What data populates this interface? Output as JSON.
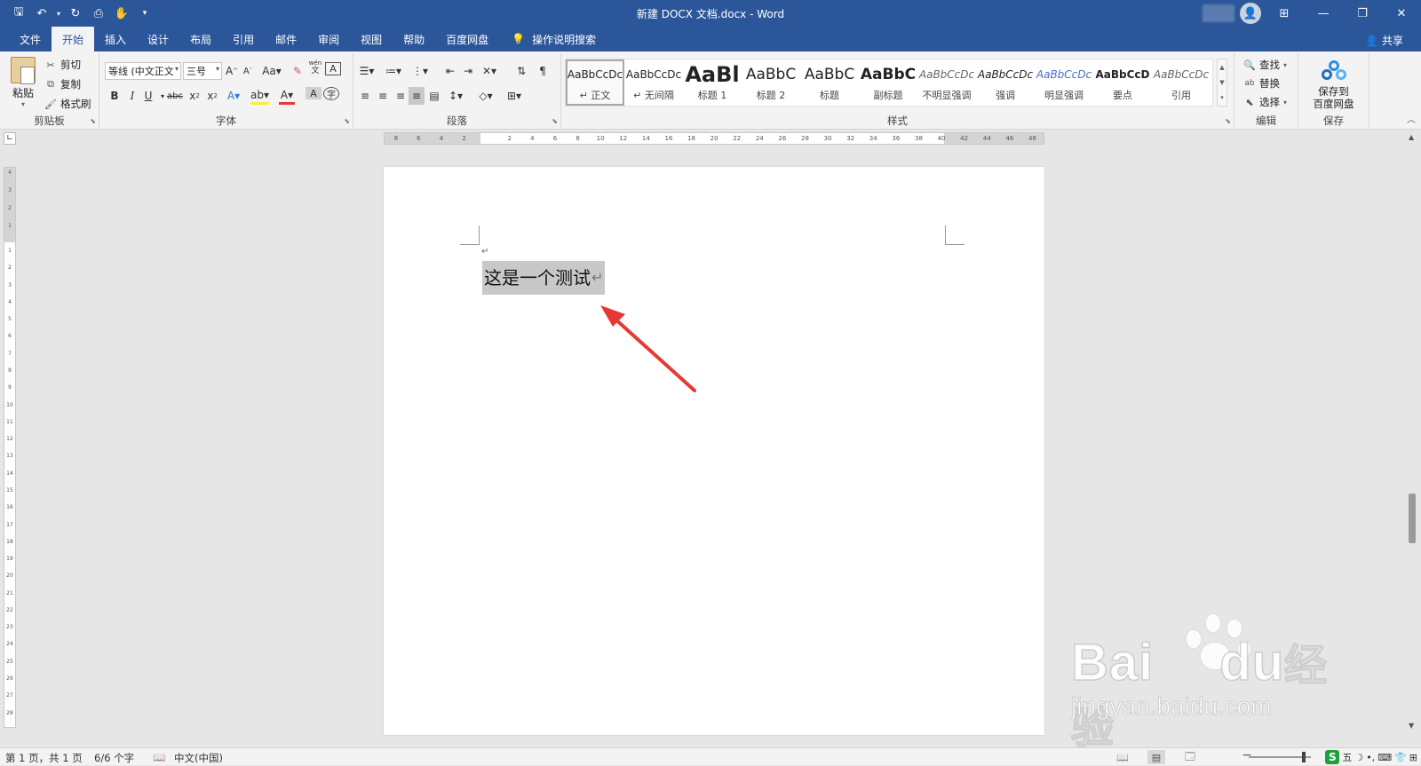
{
  "window": {
    "title": "新建 DOCX 文档.docx  -  Word"
  },
  "tabs": [
    "文件",
    "开始",
    "插入",
    "设计",
    "布局",
    "引用",
    "邮件",
    "审阅",
    "视图",
    "帮助",
    "百度网盘"
  ],
  "tellme": "操作说明搜索",
  "share": "共享",
  "clipboard": {
    "paste": "粘贴",
    "cut": "剪切",
    "copy": "复制",
    "format_painter": "格式刷",
    "label": "剪贴板"
  },
  "font": {
    "family": "等线 (中文正文",
    "size": "三号",
    "label": "字体",
    "wen": "wén",
    "wen2": "文"
  },
  "paragraph": {
    "label": "段落"
  },
  "styles": {
    "label": "样式",
    "items": [
      {
        "preview": "AaBbCcDc",
        "name": "↵ 正文"
      },
      {
        "preview": "AaBbCcDc",
        "name": "↵ 无间隔"
      },
      {
        "preview": "AaBl",
        "name": "标题 1"
      },
      {
        "preview": "AaBbC",
        "name": "标题 2"
      },
      {
        "preview": "AaBbC",
        "name": "标题"
      },
      {
        "preview": "AaBbC",
        "name": "副标题"
      },
      {
        "preview": "AaBbCcDc",
        "name": "不明显强调"
      },
      {
        "preview": "AaBbCcDc",
        "name": "强调"
      },
      {
        "preview": "AaBbCcDc",
        "name": "明显强调"
      },
      {
        "preview": "AaBbCcD",
        "name": "要点"
      },
      {
        "preview": "AaBbCcDc",
        "name": "引用"
      }
    ]
  },
  "editing": {
    "find": "查找",
    "replace": "替换",
    "select": "选择",
    "label": "编辑"
  },
  "save": {
    "line1": "保存到",
    "line2": "百度网盘",
    "label": "保存"
  },
  "ruler_h": [
    "8",
    "6",
    "4",
    "2",
    "",
    "2",
    "4",
    "6",
    "8",
    "10",
    "12",
    "14",
    "16",
    "18",
    "20",
    "22",
    "24",
    "26",
    "28",
    "30",
    "32",
    "34",
    "36",
    "38",
    "40",
    "42",
    "44",
    "46",
    "48"
  ],
  "ruler_v": [
    "1",
    "2",
    "3",
    "4",
    "5",
    "6",
    "7",
    "8",
    "9",
    "10",
    "11",
    "12",
    "13",
    "14",
    "15",
    "16",
    "17",
    "18",
    "19",
    "20",
    "21",
    "22",
    "23",
    "24",
    "25",
    "26",
    "27",
    "28"
  ],
  "ruler_v_top": [
    "4",
    "3",
    "2",
    "1"
  ],
  "document": {
    "para_mark": "↵",
    "selected_text": "这是一个测试",
    "text_para_mark": "↵"
  },
  "status": {
    "page": "第 1 页，共 1 页",
    "words": "6/6 个字",
    "language": "中文(中国)"
  },
  "ime": {
    "logo": "S",
    "mode": "五"
  },
  "watermark": {
    "brand": "Bai",
    "brand2": "du",
    "brand_cn": "经验",
    "url": "jingyan.baidu.com"
  },
  "colors": {
    "accent": "#2b579a",
    "arrow": "#e53935",
    "selection": "#c8c8c8"
  }
}
